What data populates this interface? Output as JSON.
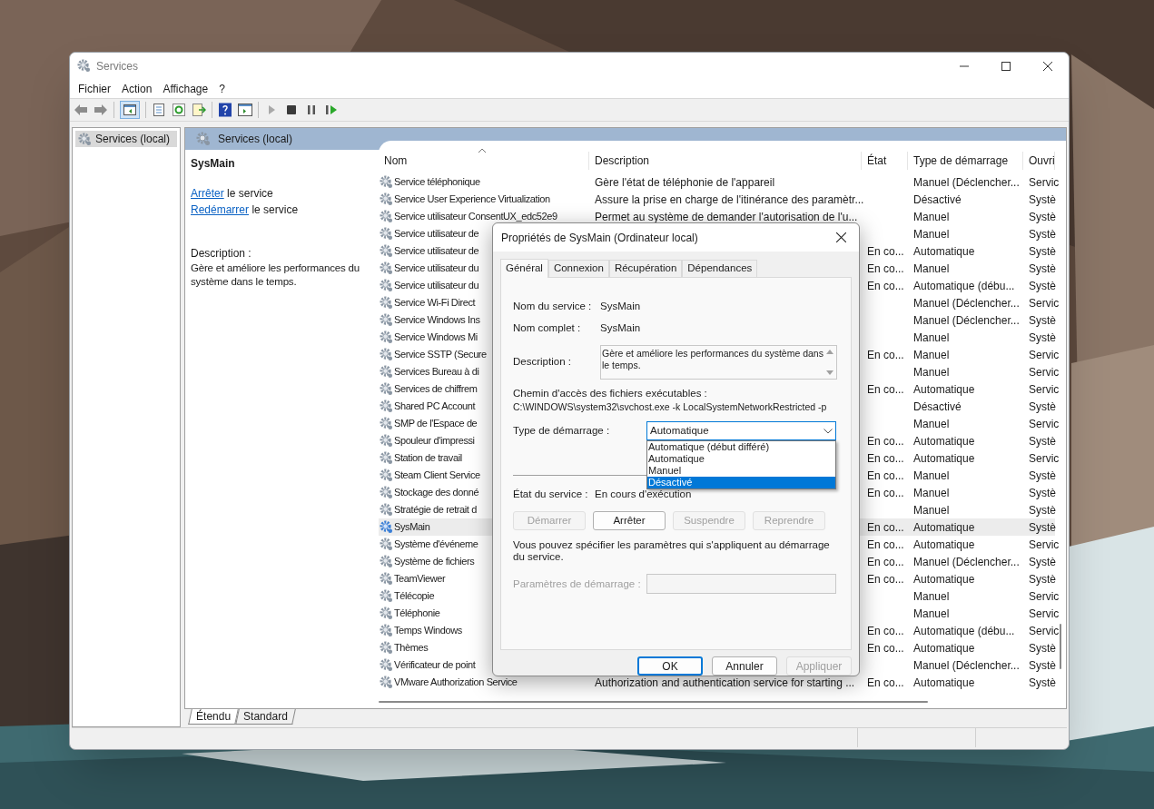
{
  "window": {
    "title": "Services"
  },
  "menu": [
    "Fichier",
    "Action",
    "Affichage",
    "?"
  ],
  "tree": [
    {
      "label": "Services (local)",
      "selected": true
    }
  ],
  "pane_header": "Services (local)",
  "details": {
    "title": "SysMain",
    "actions": [
      {
        "link": "Arrêter",
        "text": "le service"
      },
      {
        "link": "Redémarrer",
        "text": "le service"
      }
    ],
    "description_label": "Description :",
    "description": "Gère et améliore les performances du système dans le temps."
  },
  "table": {
    "columns": [
      "Nom",
      "Description",
      "État",
      "Type de démarrage",
      "Ouvri"
    ],
    "rows": [
      {
        "name": "Service téléphonique",
        "description": "Gère l'état de téléphonie de l'appareil",
        "state": "",
        "startup": "Manuel (Déclencher...",
        "logon": "Servic",
        "selected": false
      },
      {
        "name": "Service User Experience Virtualization",
        "description": "Assure la prise en charge de l'itinérance des paramètr...",
        "state": "",
        "startup": "Désactivé",
        "logon": "Systè",
        "selected": false
      },
      {
        "name": "Service utilisateur ConsentUX_edc52e9",
        "description": "Permet au système de demander l'autorisation de l'u...",
        "state": "",
        "startup": "Manuel",
        "logon": "Systè",
        "selected": false
      },
      {
        "name": "Service utilisateur de",
        "description": "",
        "state": "",
        "startup": "Manuel",
        "logon": "Systè",
        "selected": false
      },
      {
        "name": "Service utilisateur de",
        "description": "",
        "state": "En co...",
        "startup": "Automatique",
        "logon": "Systè",
        "selected": false
      },
      {
        "name": "Service utilisateur du",
        "description": "",
        "state": "En co...",
        "startup": "Manuel",
        "logon": "Systè",
        "selected": false
      },
      {
        "name": "Service utilisateur du",
        "description": "",
        "state": "En co...",
        "startup": "Automatique (débu...",
        "logon": "Systè",
        "selected": false
      },
      {
        "name": "Service Wi-Fi Direct",
        "description": "",
        "state": "",
        "startup": "Manuel (Déclencher...",
        "logon": "Servic",
        "selected": false
      },
      {
        "name": "Service Windows Ins",
        "description": "",
        "state": "",
        "startup": "Manuel (Déclencher...",
        "logon": "Systè",
        "selected": false
      },
      {
        "name": "Service Windows Mi",
        "description": "",
        "state": "",
        "startup": "Manuel",
        "logon": "Systè",
        "selected": false
      },
      {
        "name": "Service SSTP (Secure",
        "description": "",
        "state": "En co...",
        "startup": "Manuel",
        "logon": "Servic",
        "selected": false
      },
      {
        "name": "Services Bureau à di",
        "description": "",
        "state": "",
        "startup": "Manuel",
        "logon": "Servic",
        "selected": false
      },
      {
        "name": "Services de chiffrem",
        "description": "",
        "state": "En co...",
        "startup": "Automatique",
        "logon": "Servic",
        "selected": false
      },
      {
        "name": "Shared PC Account",
        "description": "",
        "state": "",
        "startup": "Désactivé",
        "logon": "Systè",
        "selected": false
      },
      {
        "name": "SMP de l'Espace de",
        "description": "",
        "state": "",
        "startup": "Manuel",
        "logon": "Servic",
        "selected": false
      },
      {
        "name": "Spouleur d'impressi",
        "description": "",
        "state": "En co...",
        "startup": "Automatique",
        "logon": "Systè",
        "selected": false
      },
      {
        "name": "Station de travail",
        "description": "",
        "state": "En co...",
        "startup": "Automatique",
        "logon": "Servic",
        "selected": false
      },
      {
        "name": "Steam Client Service",
        "description": "",
        "state": "En co...",
        "startup": "Manuel",
        "logon": "Systè",
        "selected": false
      },
      {
        "name": "Stockage des donné",
        "description": "",
        "state": "En co...",
        "startup": "Manuel",
        "logon": "Systè",
        "selected": false
      },
      {
        "name": "Stratégie de retrait d",
        "description": "",
        "state": "",
        "startup": "Manuel",
        "logon": "Systè",
        "selected": false
      },
      {
        "name": "SysMain",
        "description": "",
        "state": "En co...",
        "startup": "Automatique",
        "logon": "Systè",
        "selected": true
      },
      {
        "name": "Système d'événeme",
        "description": "",
        "state": "En co...",
        "startup": "Automatique",
        "logon": "Servic",
        "selected": false
      },
      {
        "name": "Système de fichiers",
        "description": "",
        "state": "En co...",
        "startup": "Manuel (Déclencher...",
        "logon": "Systè",
        "selected": false
      },
      {
        "name": "TeamViewer",
        "description": "",
        "state": "En co...",
        "startup": "Automatique",
        "logon": "Systè",
        "selected": false
      },
      {
        "name": "Télécopie",
        "description": "",
        "state": "",
        "startup": "Manuel",
        "logon": "Servic",
        "selected": false
      },
      {
        "name": "Téléphonie",
        "description": "",
        "state": "",
        "startup": "Manuel",
        "logon": "Servic",
        "selected": false
      },
      {
        "name": "Temps Windows",
        "description": "",
        "state": "En co...",
        "startup": "Automatique (débu...",
        "logon": "Servic",
        "selected": false
      },
      {
        "name": "Thèmes",
        "description": "",
        "state": "En co...",
        "startup": "Automatique",
        "logon": "Systè",
        "selected": false
      },
      {
        "name": "Vérificateur de point",
        "description": "",
        "state": "",
        "startup": "Manuel (Déclencher...",
        "logon": "Systè",
        "selected": false
      },
      {
        "name": "VMware Authorization Service",
        "description": "Authorization and authentication service for starting ...",
        "state": "En co...",
        "startup": "Automatique",
        "logon": "Systè",
        "selected": false
      }
    ]
  },
  "view_tabs": [
    {
      "label": "Étendu",
      "selected": true
    },
    {
      "label": "Standard",
      "selected": false
    }
  ],
  "dialog": {
    "title": "Propriétés de SysMain (Ordinateur local)",
    "tabs": [
      {
        "label": "Général",
        "selected": true
      },
      {
        "label": "Connexion",
        "selected": false
      },
      {
        "label": "Récupération",
        "selected": false
      },
      {
        "label": "Dépendances",
        "selected": false
      }
    ],
    "service_name_label": "Nom du service :",
    "service_name": "SysMain",
    "display_name_label": "Nom complet :",
    "display_name": "SysMain",
    "description_label": "Description :",
    "description": "Gère et améliore les performances du système dans le temps.",
    "path_label": "Chemin d'accès des fichiers exécutables :",
    "path": "C:\\WINDOWS\\system32\\svchost.exe -k LocalSystemNetworkRestricted -p",
    "startup_label": "Type de démarrage :",
    "startup_value": "Automatique",
    "startup_options": [
      {
        "label": "Automatique (début différé)",
        "selected": false
      },
      {
        "label": "Automatique",
        "selected": false
      },
      {
        "label": "Manuel",
        "selected": false
      },
      {
        "label": "Désactivé",
        "selected": true
      }
    ],
    "status_label": "État du service :",
    "status": "En cours d'exécution",
    "service_buttons": [
      {
        "label": "Démarrer",
        "disabled": true
      },
      {
        "label": "Arrêter",
        "disabled": false
      },
      {
        "label": "Suspendre",
        "disabled": true
      },
      {
        "label": "Reprendre",
        "disabled": true
      }
    ],
    "note": "Vous pouvez spécifier les paramètres qui s'appliquent au démarrage du service.",
    "params_label": "Paramètres de démarrage :",
    "buttons": [
      {
        "label": "OK",
        "disabled": false,
        "kind": "default"
      },
      {
        "label": "Annuler",
        "disabled": false,
        "kind": "normal"
      },
      {
        "label": "Appliquer",
        "disabled": true,
        "kind": "normal"
      }
    ]
  }
}
